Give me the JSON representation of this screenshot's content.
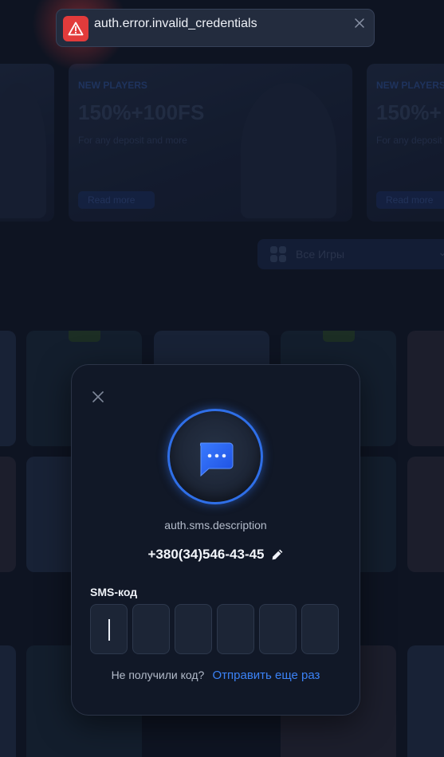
{
  "background": {
    "banners": [
      {
        "tag": "NEW PLAYERS",
        "headline": "150%+100FS",
        "subtitle": "For any deposit and more",
        "button": "Read more"
      },
      {
        "tag": "NEW PLAYERS",
        "headline": "150%+",
        "subtitle": "For any deposit and more",
        "button": "Read more"
      }
    ],
    "games_select": {
      "label": "Все Игры"
    }
  },
  "toast": {
    "message": "auth.error.invalid_credentials",
    "icon": "warning-triangle-icon",
    "accent": "#e23b3b"
  },
  "modal": {
    "icon": "sms-chat-icon",
    "description": "auth.sms.description",
    "phone": "+380(34)546-43-45",
    "code_label": "SMS-код",
    "code_length": 6,
    "code_values": [
      "",
      "",
      "",
      "",
      "",
      ""
    ],
    "resend_question": "Не получили код?",
    "resend_link": "Отправить еще раз",
    "accent": "#3b82f6"
  }
}
